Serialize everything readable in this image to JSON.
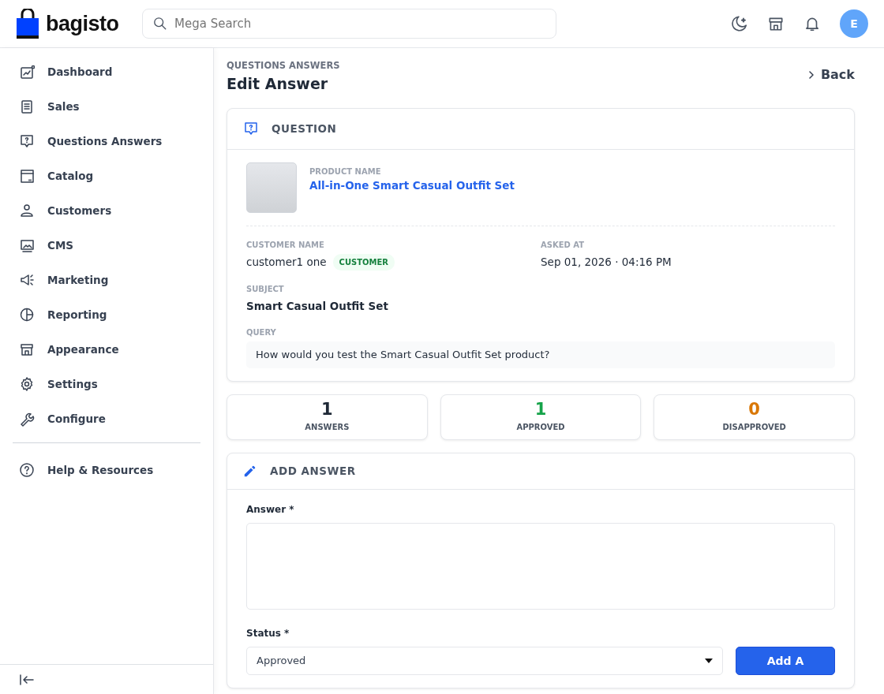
{
  "header": {
    "logo": "bagisto",
    "search_placeholder": "Mega Search",
    "avatar": "E"
  },
  "sidebar": {
    "items": [
      {
        "label": "Dashboard",
        "selected": false
      },
      {
        "label": "Sales",
        "selected": false
      },
      {
        "label": "Questions Answers",
        "selected": false
      },
      {
        "label": "Catalog",
        "selected": false
      },
      {
        "label": "Customers",
        "selected": false
      },
      {
        "label": "CMS",
        "selected": false
      },
      {
        "label": "Marketing",
        "selected": false
      },
      {
        "label": "Reporting",
        "selected": false
      },
      {
        "label": "Appearance",
        "selected": false
      },
      {
        "label": "Settings",
        "selected": false
      },
      {
        "label": "Configure",
        "selected": false
      }
    ],
    "help": {
      "label": "Help & Resources"
    }
  },
  "page": {
    "breadcrumb": "QUESTIONS ANSWERS",
    "title": "Edit Answer",
    "back": "Back"
  },
  "question": {
    "title": "QUESTION",
    "product_label": "PRODUCT NAME",
    "product_name": "All-in-One Smart Casual Outfit Set",
    "customer_label": "CUSTOMER NAME",
    "customer_name": "customer1 one",
    "customer_badge": "CUSTOMER",
    "asked_label": "ASKED AT",
    "asked_at": "Sep 01, 2026 · 04:16 PM",
    "subject_label": "SUBJECT",
    "subject": "Smart Casual Outfit Set",
    "query_label": "QUERY",
    "query": "How would you test the Smart Casual Outfit Set product?"
  },
  "stats": [
    {
      "value": "1",
      "label": "ANSWERS",
      "color": "#1f2937"
    },
    {
      "value": "1",
      "label": "APPROVED",
      "color": "#16a34a"
    },
    {
      "value": "0",
      "label": "DISAPPROVED",
      "color": "#d97706"
    }
  ],
  "answer_form": {
    "title": "ADD ANSWER",
    "answer_label": "Answer *",
    "status_label": "Status *",
    "status_value": "Approved",
    "submit": "Add A"
  }
}
